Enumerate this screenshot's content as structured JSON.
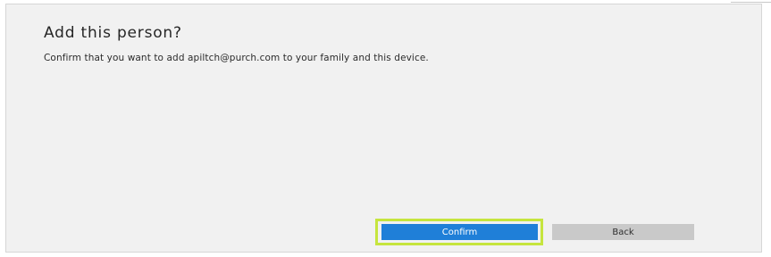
{
  "dialog": {
    "title": "Add this person?",
    "message": "Confirm that you want to add apiltch@purch.com to your family and this device."
  },
  "buttons": {
    "confirm_label": "Confirm",
    "back_label": "Back"
  },
  "colors": {
    "primary": "#1f7fd8",
    "focus_highlight": "#c6e53e",
    "secondary": "#c9c9c9"
  }
}
